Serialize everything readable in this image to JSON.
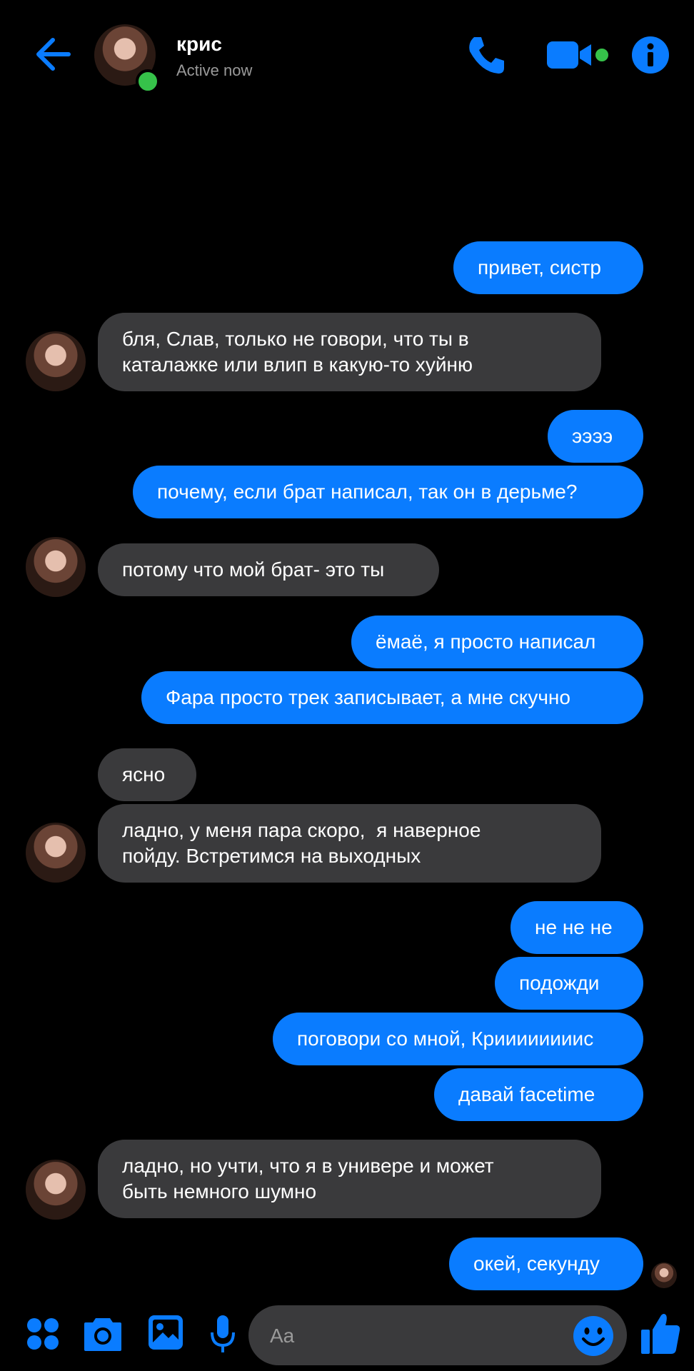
{
  "header": {
    "contact_name": "крис",
    "status": "Active now",
    "icons": [
      "back-arrow-icon",
      "phone-icon",
      "video-call-icon",
      "info-icon"
    ]
  },
  "messages": [
    {
      "from": "me",
      "text": "привет, систр"
    },
    {
      "from": "them",
      "text": "бля, Слав, только не говори, что ты в\nкаталажке или влип в какую-то хуйню"
    },
    {
      "from": "me",
      "text": "ээээ"
    },
    {
      "from": "me",
      "text": "почему, если брат написал, так он в дерьме?"
    },
    {
      "from": "them",
      "text": "потому что мой брат- это ты"
    },
    {
      "from": "me",
      "text": "ёмаё, я просто написал"
    },
    {
      "from": "me",
      "text": "Фара просто трек записывает, а мне скучно"
    },
    {
      "from": "them",
      "text": "ясно"
    },
    {
      "from": "them",
      "text": "ладно, у меня пара скоро,  я наверное\nпойду. Встретимся на выходных"
    },
    {
      "from": "me",
      "text": "не не не"
    },
    {
      "from": "me",
      "text": "подожди"
    },
    {
      "from": "me",
      "text": "поговори со мной, Криииииииис"
    },
    {
      "from": "me",
      "text": "давай facetime"
    },
    {
      "from": "them",
      "text": "ладно, но учти, что я в универе и может\nбыть немного шумно"
    },
    {
      "from": "me",
      "text": "окей, секунду"
    }
  ],
  "composer": {
    "placeholder": "Aa",
    "icons": [
      "apps-grid-icon",
      "camera-icon",
      "gallery-icon",
      "microphone-icon",
      "emoji-icon",
      "like-thumb-icon"
    ]
  },
  "colors": {
    "accent": "#0a7cff",
    "incoming_bubble": "#3a3a3c",
    "online": "#36c24a"
  }
}
